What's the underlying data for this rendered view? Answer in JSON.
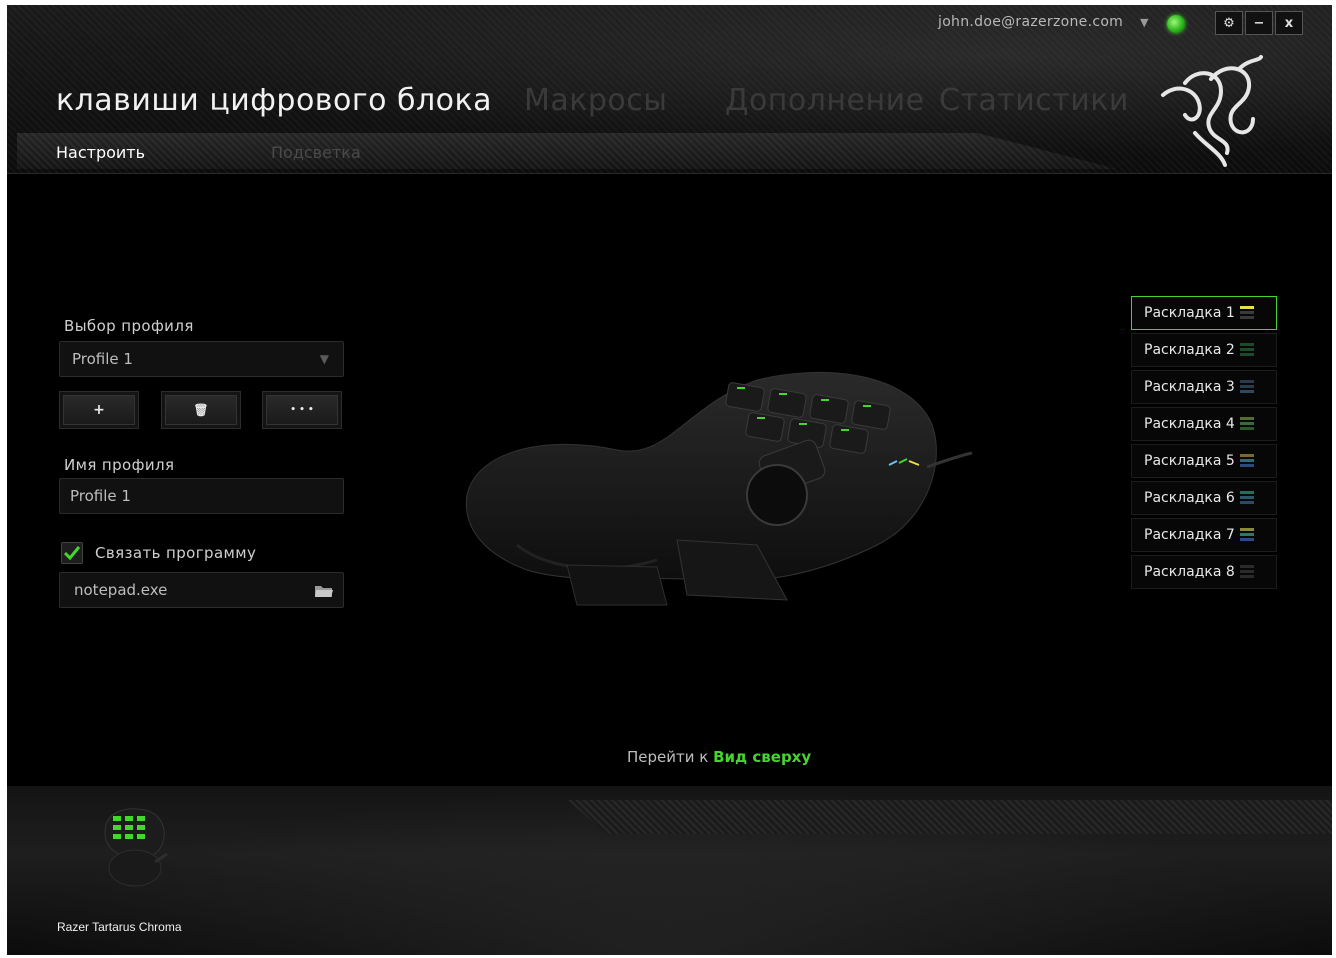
{
  "header": {
    "account": "john.doe@razerzone.com",
    "title": "клавиши цифрового блока",
    "tabs": [
      "Макросы",
      "Дополнение",
      "Статистики"
    ],
    "subtabs": {
      "active": "Настроить",
      "inactive": "Подсветка"
    },
    "window_buttons": {
      "settings": "⚙",
      "minimize": "−",
      "close": "x"
    }
  },
  "profile": {
    "select_label": "Выбор профиля",
    "selected": "Profile 1",
    "buttons": {
      "add": "+",
      "delete": "🗑",
      "more": "• • •"
    },
    "name_label": "Имя профиля",
    "name_value": "Profile 1",
    "link_program_label": "Связать программу",
    "link_program_checked": true,
    "program": "notepad.exe"
  },
  "layouts": {
    "active_index": 0,
    "items": [
      {
        "label": "Раскладка 1",
        "icon_colors": [
          "#e8e048",
          "#3a3a3a",
          "#3a3a3a"
        ]
      },
      {
        "label": "Раскладка 2",
        "icon_colors": [
          "#1e4a2a",
          "#1e4a2a",
          "#1e4a2a"
        ]
      },
      {
        "label": "Раскладка 3",
        "icon_colors": [
          "#2a3a4a",
          "#2a3a4a",
          "#2a4a6a"
        ]
      },
      {
        "label": "Раскладка 4",
        "icon_colors": [
          "#5a6a2a",
          "#3a6a3a",
          "#2a5a2a"
        ]
      },
      {
        "label": "Раскладка 5",
        "icon_colors": [
          "#7a6a2a",
          "#2a6a7a",
          "#2a4a7a"
        ]
      },
      {
        "label": "Раскладка 6",
        "icon_colors": [
          "#2a6a5a",
          "#2a5a6a",
          "#2a4a6a"
        ]
      },
      {
        "label": "Раскладка 7",
        "icon_colors": [
          "#8a8a3a",
          "#2a7a6a",
          "#2a4a8a"
        ]
      },
      {
        "label": "Раскладка 8",
        "icon_colors": [
          "#2a2a2a",
          "#2a2a2a",
          "#2a2a2a"
        ]
      }
    ]
  },
  "goto": {
    "prefix": "Перейти к",
    "link": "Вид сверху"
  },
  "footer": {
    "device_name": "Razer Tartarus Chroma"
  },
  "colors": {
    "accent": "#44d62c"
  }
}
